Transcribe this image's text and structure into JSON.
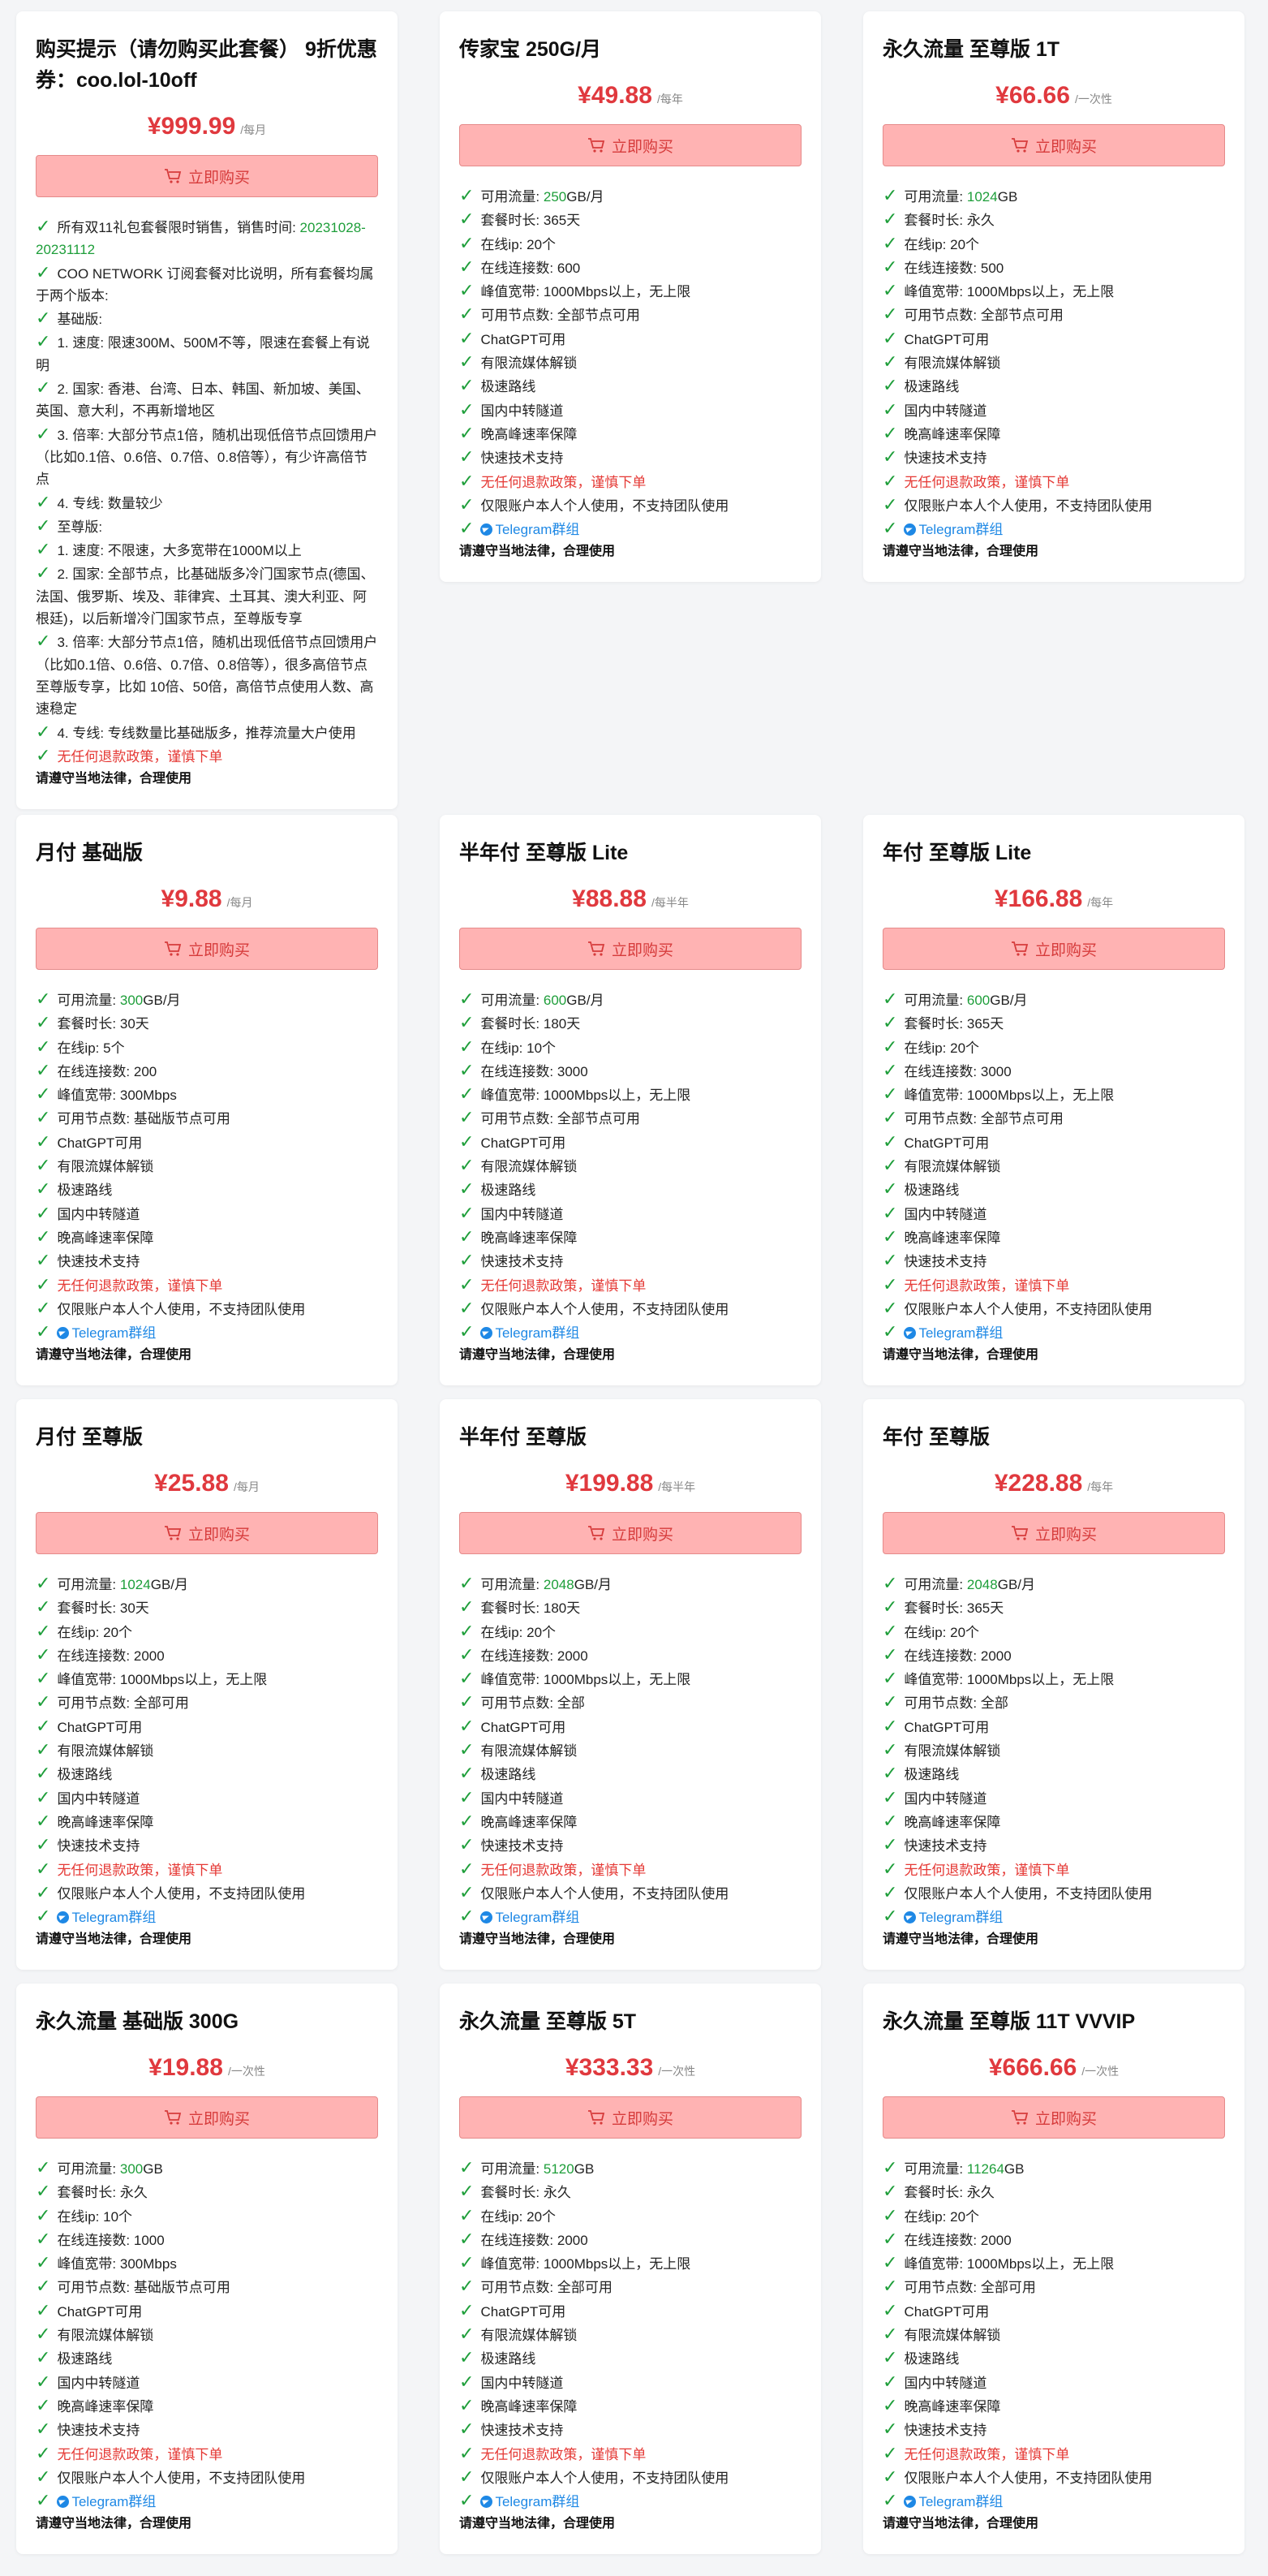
{
  "buy_label": "立即购买",
  "footer": "请遵守当地法律，合理使用",
  "colors": {
    "accent_red": "#e0393e",
    "button_bg": "#ffb3b3",
    "check_green": "#1e9e3a",
    "telegram_blue": "#1e88e5"
  },
  "first_card": {
    "title": "购买提示（请勿购买此套餐） 9折优惠券：coo.lol-10off",
    "price": "¥999.99",
    "period": "/每月",
    "lines": [
      {
        "pre": "所有双11礼包套餐限时销售，销售时间: ",
        "hl": "20231028-20231112",
        "post": ""
      },
      {
        "pre": "COO NETWORK 订阅套餐对比说明，所有套餐均属于两个版本:",
        "hl": "",
        "post": ""
      },
      {
        "pre": "基础版:",
        "hl": "",
        "post": ""
      },
      {
        "pre": "1. 速度: 限速300M、500M不等，限速在套餐上有说明",
        "hl": "",
        "post": ""
      },
      {
        "pre": "2. 国家: 香港、台湾、日本、韩国、新加坡、美国、英国、意大利，不再新增地区",
        "hl": "",
        "post": ""
      },
      {
        "pre": "3. 倍率: 大部分节点1倍，随机出现低倍节点回馈用户（比如0.1倍、0.6倍、0.7倍、0.8倍等），有少许高倍节点",
        "hl": "",
        "post": ""
      },
      {
        "pre": "4. 专线: 数量较少",
        "hl": "",
        "post": ""
      },
      {
        "pre": "至尊版:",
        "hl": "",
        "post": ""
      },
      {
        "pre": "1. 速度: 不限速，大多宽带在1000M以上",
        "hl": "",
        "post": ""
      },
      {
        "pre": "2. 国家: 全部节点，比基础版多冷门国家节点(德国、法国、俄罗斯、埃及、菲律宾、土耳其、澳大利亚、阿根廷)，以后新增冷门国家节点，至尊版专享",
        "hl": "",
        "post": ""
      },
      {
        "pre": "3. 倍率: 大部分节点1倍，随机出现低倍节点回馈用户（比如0.1倍、0.6倍、0.7倍、0.8倍等），很多高倍节点至尊版专享，比如 10倍、50倍，高倍节点使用人数、高速稳定",
        "hl": "",
        "post": ""
      },
      {
        "pre": "4. 专线: 专线数量比基础版多，推荐流量大户使用",
        "hl": "",
        "post": ""
      }
    ],
    "refund": "无任何退款政策，谨慎下单"
  },
  "labels": {
    "traffic": "可用流量: ",
    "duration": "套餐时长: ",
    "online_ip": "在线ip: ",
    "connections": "在线连接数: ",
    "bandwidth": "峰值宽带: ",
    "nodes": "可用节点数: ",
    "chatgpt": "ChatGPT可用",
    "streaming": "有限流媒体解锁",
    "fast_route": "极速路线",
    "tunnel": "国内中转隧道",
    "peak_guarantee": "晚高峰速率保障",
    "support": "快速技术支持",
    "refund": "无任何退款政策，谨慎下单",
    "personal": "仅限账户本人个人使用，不支持团队使用",
    "telegram": "Telegram群组"
  },
  "plans": [
    {
      "title": "传家宝 250G/月",
      "price": "¥49.88",
      "period": "/每年",
      "traffic": "250",
      "unit": "GB/月",
      "duration": "365天",
      "ip": "20个",
      "conn": "600",
      "bw": "1000Mbps以上，无上限",
      "nodes": "全部节点可用"
    },
    {
      "title": "永久流量 至尊版 1T",
      "price": "¥66.66",
      "period": "/一次性",
      "traffic": "1024",
      "unit": "GB",
      "duration": "永久",
      "ip": "20个",
      "conn": "500",
      "bw": "1000Mbps以上，无上限",
      "nodes": "全部节点可用"
    },
    {
      "title": "月付 基础版",
      "price": "¥9.88",
      "period": "/每月",
      "traffic": "300",
      "unit": "GB/月",
      "duration": "30天",
      "ip": "5个",
      "conn": "200",
      "bw": "300Mbps",
      "nodes": "基础版节点可用"
    },
    {
      "title": "半年付 至尊版 Lite",
      "price": "¥88.88",
      "period": "/每半年",
      "traffic": "600",
      "unit": "GB/月",
      "duration": "180天",
      "ip": "10个",
      "conn": "3000",
      "bw": "1000Mbps以上，无上限",
      "nodes": "全部节点可用"
    },
    {
      "title": "年付 至尊版 Lite",
      "price": "¥166.88",
      "period": "/每年",
      "traffic": "600",
      "unit": "GB/月",
      "duration": "365天",
      "ip": "20个",
      "conn": "3000",
      "bw": "1000Mbps以上，无上限",
      "nodes": "全部节点可用"
    },
    {
      "title": "月付 至尊版",
      "price": "¥25.88",
      "period": "/每月",
      "traffic": "1024",
      "unit": "GB/月",
      "duration": "30天",
      "ip": "20个",
      "conn": "2000",
      "bw": "1000Mbps以上，无上限",
      "nodes": "全部可用"
    },
    {
      "title": "半年付 至尊版",
      "price": "¥199.88",
      "period": "/每半年",
      "traffic": "2048",
      "unit": "GB/月",
      "duration": "180天",
      "ip": "20个",
      "conn": "2000",
      "bw": "1000Mbps以上，无上限",
      "nodes": "全部"
    },
    {
      "title": "年付 至尊版",
      "price": "¥228.88",
      "period": "/每年",
      "traffic": "2048",
      "unit": "GB/月",
      "duration": "365天",
      "ip": "20个",
      "conn": "2000",
      "bw": "1000Mbps以上，无上限",
      "nodes": "全部"
    },
    {
      "title": "永久流量 基础版 300G",
      "price": "¥19.88",
      "period": "/一次性",
      "traffic": "300",
      "unit": "GB",
      "duration": "永久",
      "ip": "10个",
      "conn": "1000",
      "bw": "300Mbps",
      "nodes": "基础版节点可用"
    },
    {
      "title": "永久流量 至尊版 5T",
      "price": "¥333.33",
      "period": "/一次性",
      "traffic": "5120",
      "unit": "GB",
      "duration": "永久",
      "ip": "20个",
      "conn": "2000",
      "bw": "1000Mbps以上，无上限",
      "nodes": "全部可用"
    },
    {
      "title": "永久流量 至尊版 11T VVVIP",
      "price": "¥666.66",
      "period": "/一次性",
      "traffic": "11264",
      "unit": "GB",
      "duration": "永久",
      "ip": "20个",
      "conn": "2000",
      "bw": "1000Mbps以上，无上限",
      "nodes": "全部可用"
    }
  ]
}
